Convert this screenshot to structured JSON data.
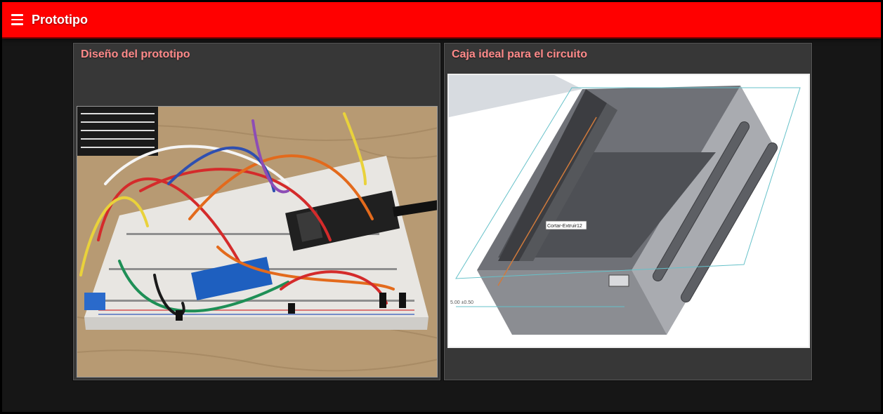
{
  "app": {
    "title": "Prototipo",
    "menu_icon": "hamburger-menu-icon",
    "header_color": "#ff0000"
  },
  "cards": [
    {
      "title": "Diseño del prototipo",
      "image_subject": "breadboard-circuit-photo"
    },
    {
      "title": "Caja ideal para el circuito",
      "image_subject": "cad-enclosure-render",
      "cad_labels": {
        "feature_tag": "Cortar-Extruir12",
        "dimension": "5.00 ±0.50"
      }
    }
  ],
  "colors": {
    "background": "#161616",
    "card_background": "#373737",
    "card_title": "#ff8a8a"
  }
}
